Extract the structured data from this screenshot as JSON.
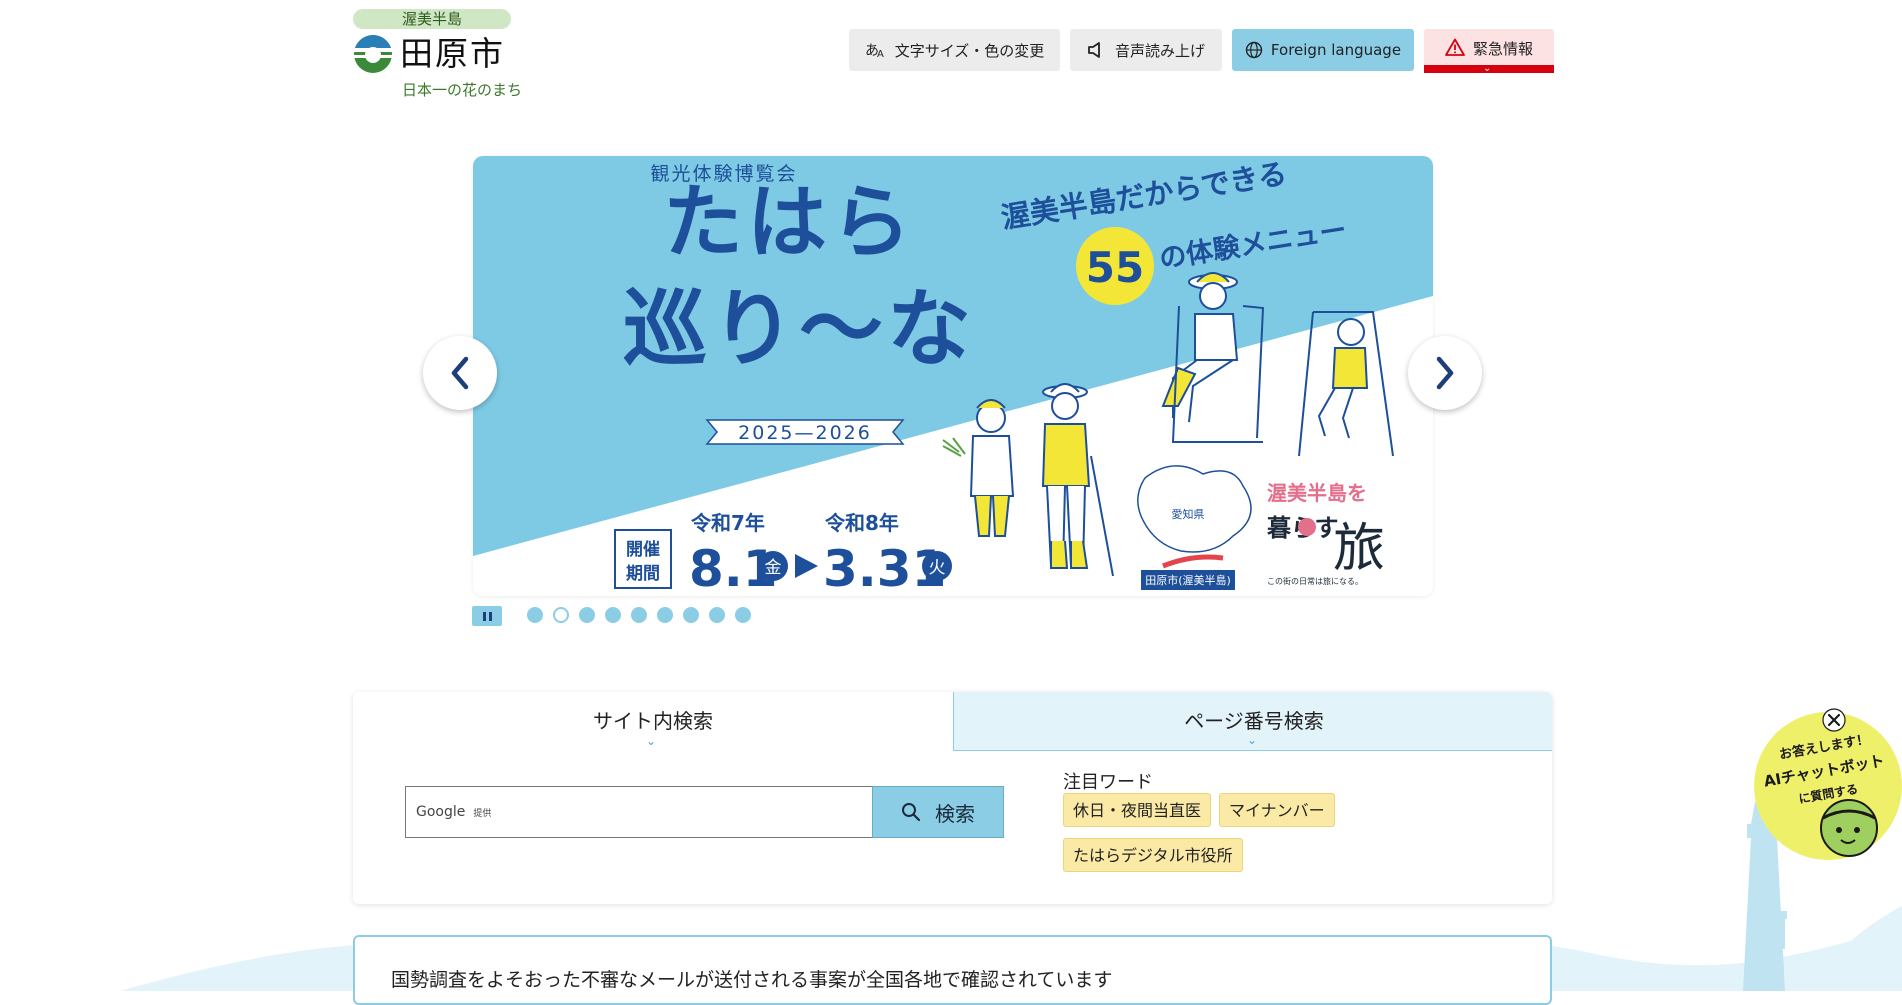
{
  "header": {
    "logo_pill": "渥美半島",
    "city_name": "田原市",
    "tagline": "日本一の花のまち",
    "buttons": {
      "text_size": "文字サイズ・色の変更",
      "voice": "音声読み上げ",
      "language": "Foreign language",
      "emergency": "緊急情報"
    }
  },
  "carousel": {
    "slide": {
      "subtitle": "観光体験博覧会",
      "title_line1": "たはら",
      "title_line2": "巡り〜な",
      "years": "2025—2026",
      "tagline1": "渥美半島だからできる",
      "count": "55",
      "tagline2": "の体験メニュー",
      "period_label_1": "開催",
      "period_label_2": "期間",
      "start_era": "令和7年",
      "start_date": "8.1",
      "start_day": "金",
      "end_era": "令和8年",
      "end_date": "3.31",
      "end_day": "火",
      "map_label": "愛知県",
      "map_caption": "田原市(渥美半島)",
      "brand_line1": "渥美半島を",
      "brand_kurasu": "暮らす",
      "brand_tabi": "旅",
      "brand_small": "この街の日常は旅になる。"
    },
    "dot_count": 9,
    "active_dot": 1
  },
  "search": {
    "tab_site": "サイト内検索",
    "tab_page": "ページ番号検索",
    "google": "Google",
    "provided": "提供",
    "button": "検索",
    "keywords_title": "注目ワード",
    "keywords": [
      "休日・夜間当直医",
      "マイナンバー",
      "たはらデジタル市役所"
    ]
  },
  "notice": {
    "text": "国勢調査をよそおった不審なメールが送付される事案が全国各地で確認されています"
  },
  "chatbot": {
    "line1": "お答えします！",
    "line2": "AIチャットボット",
    "line3": "に質問する"
  },
  "colors": {
    "accent_blue": "#8ccde6",
    "navy": "#1c3f7a",
    "emergency_red": "#d7000f",
    "keyword_yellow": "#fbe9a6",
    "logo_green": "#3b7a2a"
  }
}
